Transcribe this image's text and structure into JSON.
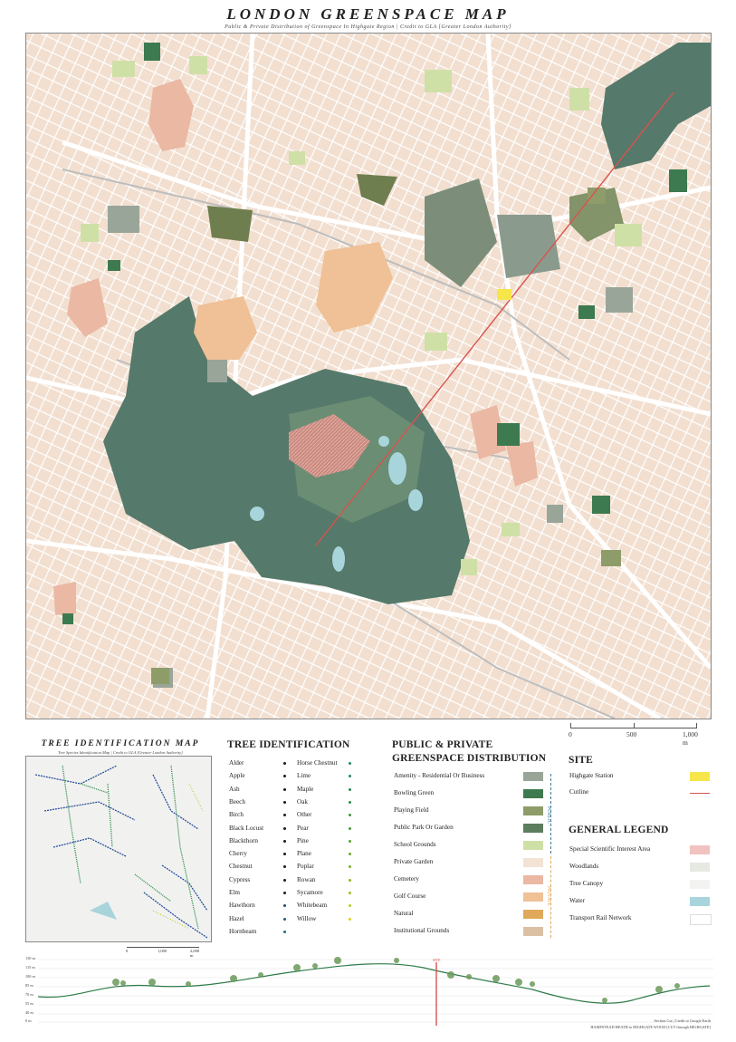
{
  "title": "LONDON GREENSPACE MAP",
  "subtitle": "Public & Private Distribution of Greenspace In Highgate Region | Credit to GLA [Greater London Authority]",
  "scale_bar": {
    "labels": [
      "0",
      "500",
      "1,000 m"
    ]
  },
  "tree_map": {
    "title": "TREE IDENTIFICATION MAP",
    "subtitle": "Tree Species Identification Map | Credit to GLA [Greater London Authority]",
    "scale_labels": [
      "0",
      "1,000",
      "2,000 m"
    ]
  },
  "tree_identification": {
    "heading": "TREE IDENTIFICATION",
    "col1": [
      {
        "name": "Alder",
        "color": "#1a1a1a"
      },
      {
        "name": "Apple",
        "color": "#1a1a1a"
      },
      {
        "name": "Ash",
        "color": "#1a1a1a"
      },
      {
        "name": "Beech",
        "color": "#1a1a1a"
      },
      {
        "name": "Birch",
        "color": "#1a1a1a"
      },
      {
        "name": "Black Locust",
        "color": "#1a1a1a"
      },
      {
        "name": "Blackthorn",
        "color": "#1a1a1a"
      },
      {
        "name": "Cherry",
        "color": "#1a1a1a"
      },
      {
        "name": "Chestnut",
        "color": "#1a1a1a"
      },
      {
        "name": "Cypress",
        "color": "#1a1a1a"
      },
      {
        "name": "Elm",
        "color": "#1a1a1a"
      },
      {
        "name": "Hawthorn",
        "color": "#1b4f7a"
      },
      {
        "name": "Hazel",
        "color": "#1b5a8c"
      },
      {
        "name": "Hornbeam",
        "color": "#1f6e7a"
      }
    ],
    "col2": [
      {
        "name": "Horse Chestnut",
        "color": "#1f8a6a"
      },
      {
        "name": "Lime",
        "color": "#1f8a5a"
      },
      {
        "name": "Maple",
        "color": "#208c50"
      },
      {
        "name": "Oak",
        "color": "#2a8f48"
      },
      {
        "name": "Other",
        "color": "#3a9640"
      },
      {
        "name": "Pear",
        "color": "#4a9a3a"
      },
      {
        "name": "Pine",
        "color": "#5aa034"
      },
      {
        "name": "Plane",
        "color": "#6aa82e"
      },
      {
        "name": "Poplar",
        "color": "#7ab02a"
      },
      {
        "name": "Rowan",
        "color": "#8ab826"
      },
      {
        "name": "Sycamore",
        "color": "#9cc024"
      },
      {
        "name": "Whitebeam",
        "color": "#b6cc20"
      },
      {
        "name": "Willow",
        "color": "#d8d21c"
      }
    ]
  },
  "distribution": {
    "heading_line1": "PUBLIC & PRIVATE",
    "heading_line2": "GREENSPACE DISTRIBUTION",
    "public_label": "PUBLIC",
    "private_label": "PRIVATE",
    "items": [
      {
        "name": "Amenity - Residential Or Business",
        "color": "#9aa59a"
      },
      {
        "name": "Bowling Green",
        "color": "#3d7a4f"
      },
      {
        "name": "Playing Field",
        "color": "#8e9c6a"
      },
      {
        "name": "Public Park Or Garden",
        "color": "#5c7d5e"
      },
      {
        "name": "School Grounds",
        "color": "#cfe0a6"
      },
      {
        "name": "Private Garden",
        "color": "#f3e3d4"
      },
      {
        "name": "Cemetery",
        "color": "#ebb8a4"
      },
      {
        "name": "Golf Course",
        "color": "#f0c096"
      },
      {
        "name": "Natural",
        "color": "#e0a85a"
      },
      {
        "name": "Institutional Grounds",
        "color": "#dcc0a4"
      }
    ]
  },
  "site": {
    "heading": "SITE",
    "items": [
      {
        "name": "Highgate Station",
        "color": "#f6e64a"
      },
      {
        "name": "Cutline",
        "color": "#d9534f"
      }
    ]
  },
  "general_legend": {
    "heading": "GENERAL LEGEND",
    "items": [
      {
        "name": "Special Scientific Interest Area",
        "color": "#f2c2c0"
      },
      {
        "name": "Woodlands",
        "color": "#e6e9e2"
      },
      {
        "name": "Tree Canopy",
        "color": "#f3f3f1"
      },
      {
        "name": "Water",
        "color": "#a8d4dc"
      },
      {
        "name": "Transport Rail Network",
        "color": "#ffffff"
      }
    ]
  },
  "section": {
    "y_labels": [
      "130 m",
      "115 m",
      "100 m",
      "85 m",
      "70 m",
      "55 m",
      "40 m",
      "0 m"
    ],
    "marker_label": "SITE",
    "caption_line1": "Section Cut | Credit to Google Earth",
    "caption_line2": "HAMPSTEAD HEATH to HIGHGATE WOOD [CUT through HIGHGATE]"
  }
}
